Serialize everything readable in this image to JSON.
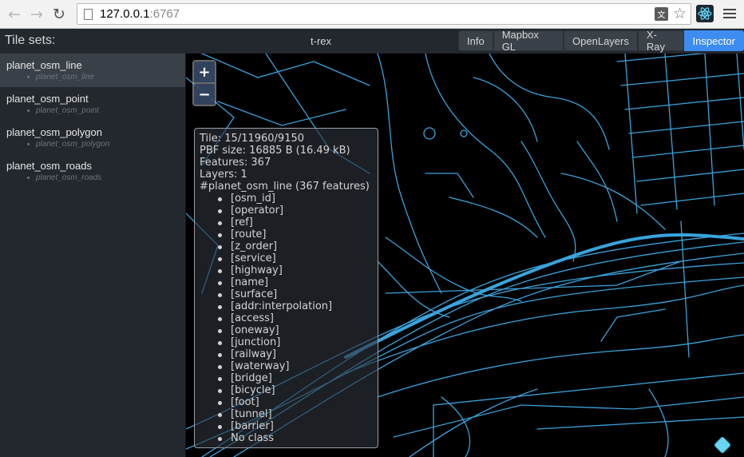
{
  "browser": {
    "url_host": "127.0.0.1",
    "url_port": ":6767",
    "back_icon": "arrow-left-icon",
    "forward_icon": "arrow-right-icon",
    "reload_icon": "reload-icon"
  },
  "header": {
    "tilesets_label": "Tile sets:",
    "title": "t-rex",
    "tabs": [
      {
        "label": "Info"
      },
      {
        "label": "Mapbox GL"
      },
      {
        "label": "OpenLayers"
      },
      {
        "label": "X-Ray"
      },
      {
        "label": "Inspector",
        "active": true
      }
    ]
  },
  "sidebar": {
    "tilesets": [
      {
        "name": "planet_osm_line",
        "layer": "planet_osm_line",
        "selected": true
      },
      {
        "name": "planet_osm_point",
        "layer": "planet_osm_point"
      },
      {
        "name": "planet_osm_polygon",
        "layer": "planet_osm_polygon"
      },
      {
        "name": "planet_osm_roads",
        "layer": "planet_osm_roads"
      }
    ]
  },
  "map": {
    "zoom_in": "+",
    "zoom_out": "−",
    "line_color": "#3aa3dc",
    "background": "#000000"
  },
  "inspector": {
    "tile": "Tile: 15/11960/9150",
    "pbf_size": "PBF size: 16885 B (16.49 kB)",
    "features": "Features: 367",
    "layers": "Layers: 1",
    "layer_heading": "#planet_osm_line (367 features)",
    "attributes": [
      "[osm_id]",
      "[operator]",
      "[ref]",
      "[route]",
      "[z_order]",
      "[service]",
      "[highway]",
      "[name]",
      "[surface]",
      "[addr:interpolation]",
      "[access]",
      "[oneway]",
      "[junction]",
      "[railway]",
      "[waterway]",
      "[bridge]",
      "[bicycle]",
      "[foot]",
      "[tunnel]",
      "[barrier]",
      "No class"
    ]
  }
}
